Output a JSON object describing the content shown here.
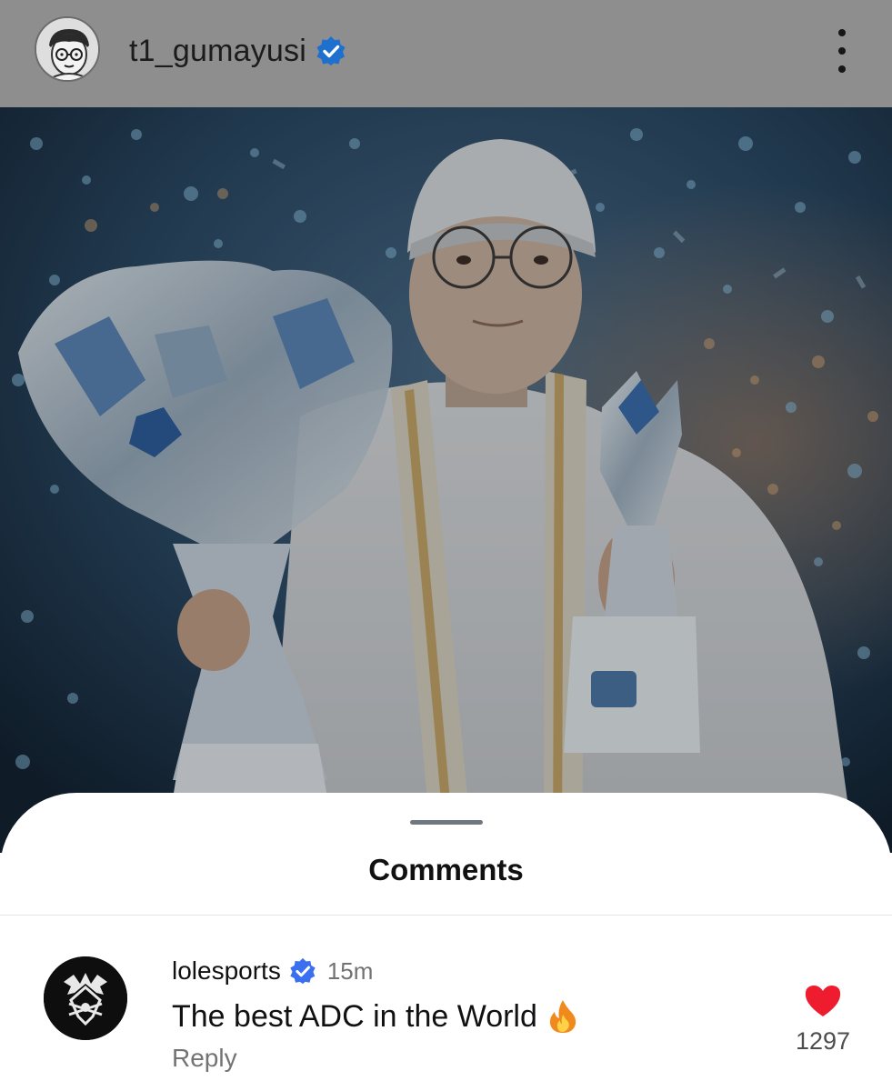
{
  "post": {
    "author": {
      "username": "t1_gumayusi",
      "verified": true
    },
    "photo": {
      "description_icon": "photo-image"
    }
  },
  "comments_sheet": {
    "title": "Comments",
    "comments": [
      {
        "author": "lolesports",
        "verified": true,
        "time": "15m",
        "text": "The best ADC in the World",
        "emoji_icon": "fire-icon",
        "reply_label": "Reply",
        "like_count": "1297",
        "liked": true
      }
    ]
  },
  "colors": {
    "verified_blue": "#1f7ae0",
    "comment_verified": "#3a6ff0",
    "like_red": "#ee1c2e",
    "header_overlay": "#8e8e8e"
  }
}
